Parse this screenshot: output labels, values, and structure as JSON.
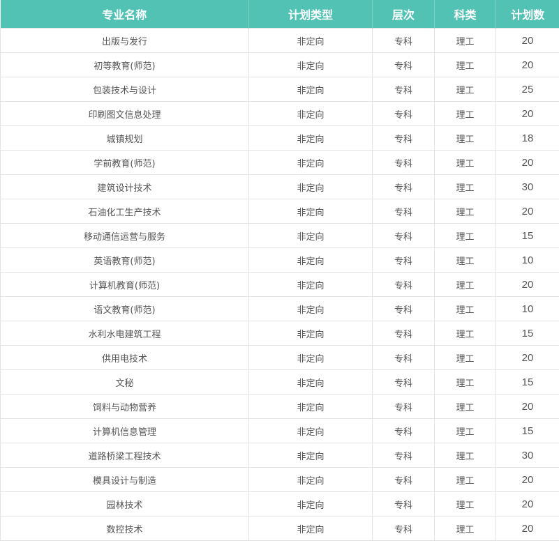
{
  "table": {
    "headers": {
      "name": "专业名称",
      "type": "计划类型",
      "level": "层次",
      "category": "科类",
      "count": "计划数"
    },
    "rows": [
      {
        "name": "出版与发行",
        "type": "非定向",
        "level": "专科",
        "category": "理工",
        "count": "20"
      },
      {
        "name": "初等教育(师范)",
        "type": "非定向",
        "level": "专科",
        "category": "理工",
        "count": "20"
      },
      {
        "name": "包装技术与设计",
        "type": "非定向",
        "level": "专科",
        "category": "理工",
        "count": "25"
      },
      {
        "name": "印刷图文信息处理",
        "type": "非定向",
        "level": "专科",
        "category": "理工",
        "count": "20"
      },
      {
        "name": "城镇规划",
        "type": "非定向",
        "level": "专科",
        "category": "理工",
        "count": "18"
      },
      {
        "name": "学前教育(师范)",
        "type": "非定向",
        "level": "专科",
        "category": "理工",
        "count": "20"
      },
      {
        "name": "建筑设计技术",
        "type": "非定向",
        "level": "专科",
        "category": "理工",
        "count": "30"
      },
      {
        "name": "石油化工生产技术",
        "type": "非定向",
        "level": "专科",
        "category": "理工",
        "count": "20"
      },
      {
        "name": "移动通信运营与服务",
        "type": "非定向",
        "level": "专科",
        "category": "理工",
        "count": "15"
      },
      {
        "name": "英语教育(师范)",
        "type": "非定向",
        "level": "专科",
        "category": "理工",
        "count": "10"
      },
      {
        "name": "计算机教育(师范)",
        "type": "非定向",
        "level": "专科",
        "category": "理工",
        "count": "20"
      },
      {
        "name": "语文教育(师范)",
        "type": "非定向",
        "level": "专科",
        "category": "理工",
        "count": "10"
      },
      {
        "name": "水利水电建筑工程",
        "type": "非定向",
        "level": "专科",
        "category": "理工",
        "count": "15"
      },
      {
        "name": "供用电技术",
        "type": "非定向",
        "level": "专科",
        "category": "理工",
        "count": "20"
      },
      {
        "name": "文秘",
        "type": "非定向",
        "level": "专科",
        "category": "理工",
        "count": "15"
      },
      {
        "name": "饲料与动物营养",
        "type": "非定向",
        "level": "专科",
        "category": "理工",
        "count": "20"
      },
      {
        "name": "计算机信息管理",
        "type": "非定向",
        "level": "专科",
        "category": "理工",
        "count": "15"
      },
      {
        "name": "道路桥梁工程技术",
        "type": "非定向",
        "level": "专科",
        "category": "理工",
        "count": "30"
      },
      {
        "name": "模具设计与制造",
        "type": "非定向",
        "level": "专科",
        "category": "理工",
        "count": "20"
      },
      {
        "name": "园林技术",
        "type": "非定向",
        "level": "专科",
        "category": "理工",
        "count": "20"
      },
      {
        "name": "数控技术",
        "type": "非定向",
        "level": "专科",
        "category": "理工",
        "count": "20"
      }
    ]
  },
  "colors": {
    "header_bg": "#52c2b4",
    "header_text": "#ffffff",
    "border": "#e3e3e3",
    "cell_text": "#555555"
  }
}
